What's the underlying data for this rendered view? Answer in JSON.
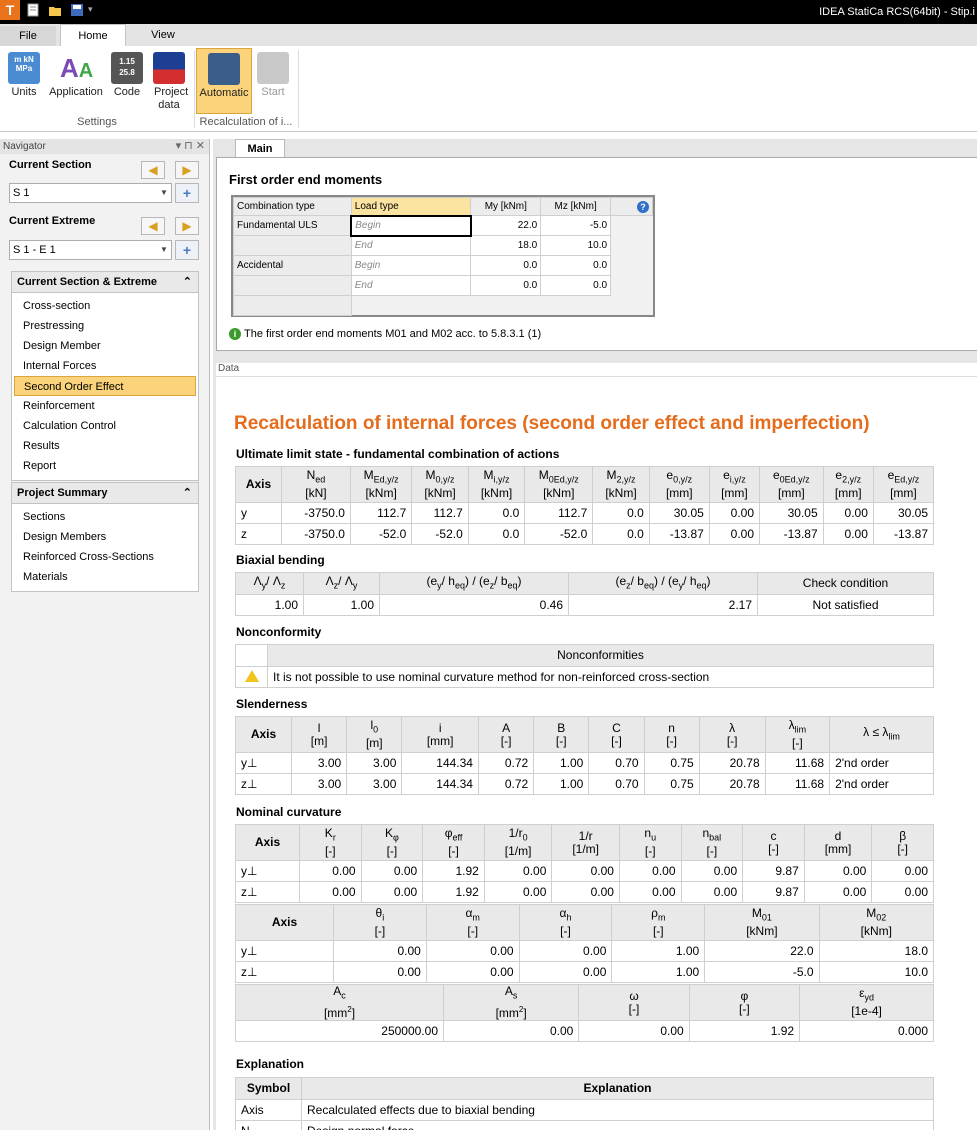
{
  "app": {
    "title": "IDEA StatiCa RCS(64bit) - Stip.i"
  },
  "ribbon_tabs": [
    "File",
    "Home",
    "View"
  ],
  "ribbon": {
    "buttons": [
      "Units",
      "Application",
      "Code",
      "Project data",
      "Automatic",
      "Start"
    ],
    "units_icon_text": "m kN MPa",
    "code_icon_text": "1.15 25.8",
    "groups": [
      "Settings",
      "Recalculation of i..."
    ]
  },
  "nav": {
    "title": "Navigator",
    "current_section_label": "Current Section",
    "current_section_value": "S 1",
    "current_extreme_label": "Current Extreme",
    "current_extreme_value": "S 1 - E 1",
    "cse_title": "Current Section & Extreme",
    "cse_items": [
      "Cross-section",
      "Prestressing",
      "Design Member",
      "Internal Forces",
      "Second Order Effect",
      "Reinforcement",
      "Calculation Control",
      "Results",
      "Report"
    ],
    "cse_selected": "Second Order Effect",
    "ps_title": "Project Summary",
    "ps_items": [
      "Sections",
      "Design Members",
      "Reinforced Cross-Sections",
      "Materials"
    ]
  },
  "main_tab": "Main",
  "first_order": {
    "title": "First order end moments",
    "headers": [
      "Combination type",
      "Load type",
      "My [kNm]",
      "Mz [kNm]"
    ],
    "rows": [
      {
        "comb": "Fundamental ULS",
        "load": "Begin",
        "my": "22.0",
        "mz": "-5.0"
      },
      {
        "comb": "",
        "load": "End",
        "my": "18.0",
        "mz": "10.0"
      },
      {
        "comb": "Accidental",
        "load": "Begin",
        "my": "0.0",
        "mz": "0.0"
      },
      {
        "comb": "",
        "load": "End",
        "my": "0.0",
        "mz": "0.0"
      }
    ],
    "info": "The first order end moments M01 and M02 acc. to 5.8.3.1 (1)"
  },
  "data_label": "Data",
  "report": {
    "title": "Recalculation of internal forces (second order effect and imperfection)",
    "s1": "Ultimate limit state - fundamental combination of actions",
    "t1": {
      "rows": [
        [
          "y",
          "-3750.0",
          "112.7",
          "112.7",
          "0.0",
          "112.7",
          "0.0",
          "30.05",
          "0.00",
          "30.05",
          "0.00",
          "30.05"
        ],
        [
          "z",
          "-3750.0",
          "-52.0",
          "-52.0",
          "0.0",
          "-52.0",
          "0.0",
          "-13.87",
          "0.00",
          "-13.87",
          "0.00",
          "-13.87"
        ]
      ]
    },
    "s2": "Biaxial bending",
    "t2": {
      "headers": [
        "Check condition"
      ],
      "row": [
        "1.00",
        "1.00",
        "0.46",
        "2.17",
        "Not satisfied"
      ]
    },
    "s3": "Nonconformity",
    "t3": {
      "header": "Nonconformities",
      "text": "It is not possible to use nominal curvature method for non-reinforced cross-section"
    },
    "s4": "Slenderness",
    "t4": {
      "rows": [
        [
          "y⊥",
          "3.00",
          "3.00",
          "144.34",
          "0.72",
          "1.00",
          "0.70",
          "0.75",
          "20.78",
          "11.68",
          "2'nd order"
        ],
        [
          "z⊥",
          "3.00",
          "3.00",
          "144.34",
          "0.72",
          "1.00",
          "0.70",
          "0.75",
          "20.78",
          "11.68",
          "2'nd order"
        ]
      ]
    },
    "s5": "Nominal curvature",
    "t5": {
      "rows": [
        [
          "y⊥",
          "0.00",
          "0.00",
          "1.92",
          "0.00",
          "0.00",
          "0.00",
          "0.00",
          "9.87",
          "0.00",
          "0.00"
        ],
        [
          "z⊥",
          "0.00",
          "0.00",
          "1.92",
          "0.00",
          "0.00",
          "0.00",
          "0.00",
          "9.87",
          "0.00",
          "0.00"
        ]
      ]
    },
    "t6": {
      "rows": [
        [
          "y⊥",
          "0.00",
          "0.00",
          "0.00",
          "1.00",
          "22.0",
          "18.0"
        ],
        [
          "z⊥",
          "0.00",
          "0.00",
          "0.00",
          "1.00",
          "-5.0",
          "10.0"
        ]
      ]
    },
    "t7": {
      "row": [
        "250000.00",
        "0.00",
        "0.00",
        "1.92",
        "0.000"
      ]
    },
    "s6": "Explanation",
    "t8": {
      "headers": [
        "Symbol",
        "Explanation"
      ],
      "rows": [
        [
          "Axis",
          "Recalculated effects due to biaxial bending"
        ],
        [
          "N",
          "Design normal force"
        ]
      ]
    }
  }
}
